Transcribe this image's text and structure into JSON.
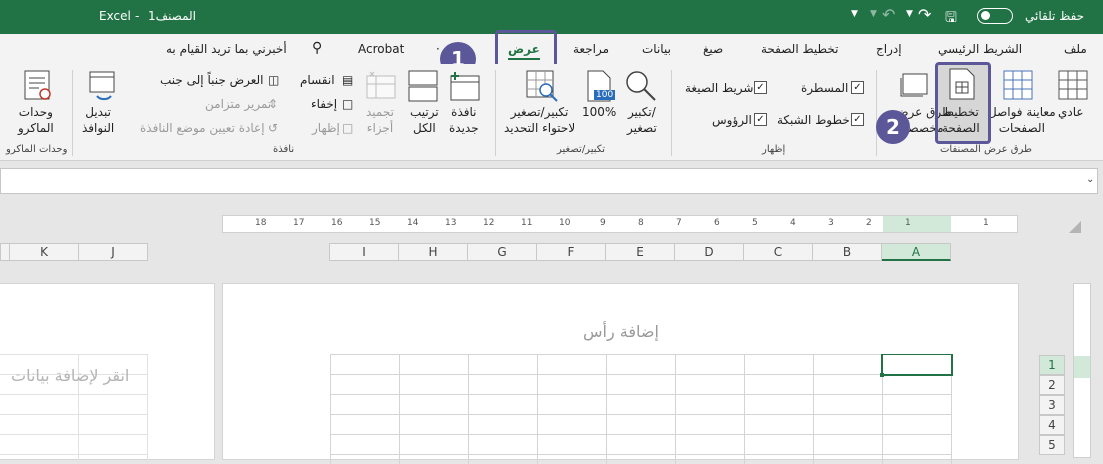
{
  "titlebar": {
    "autosave_label": "حفظ تلقائي",
    "doc_title": "المصنف1",
    "separator": "-",
    "app_name": "Excel"
  },
  "tabs": [
    {
      "label": "ملف"
    },
    {
      "label": "الشريط الرئيسي"
    },
    {
      "label": "إدراج"
    },
    {
      "label": "تخطيط الصفحة"
    },
    {
      "label": "صيغ"
    },
    {
      "label": "بيانات"
    },
    {
      "label": "مراجعة"
    },
    {
      "label": "عرض",
      "active": true
    },
    {
      "label": "Acrobat"
    }
  ],
  "tellme": "أخبرني بما تريد القيام به",
  "ribbon": {
    "workbook_views": {
      "group_label": "طرق عرض المصنفات",
      "normal": "عادي",
      "page_break_l1": "معاينة فواصل",
      "page_break_l2": "الصفحات",
      "page_layout_l1": "تخطيط",
      "page_layout_l2": "الصفحة",
      "custom_l1": "طرق عرض",
      "custom_l2": "مخصصة"
    },
    "show": {
      "group_label": "إظهار",
      "ruler": "المسطرة",
      "formula_bar": "شريط الصيغة",
      "gridlines": "خطوط الشبكة",
      "headings": "الرؤوس"
    },
    "zoom": {
      "group_label": "تكبير/تصغير",
      "zoom_l1": "تكبير/",
      "zoom_l2": "تصغير",
      "hundred": "100%",
      "badge": "100",
      "to_selection_l1": "تكبير/تصغير",
      "to_selection_l2": "لاحتواء التحديد"
    },
    "window": {
      "group_label": "نافذة",
      "new_window_l1": "نافذة",
      "new_window_l2": "جديدة",
      "arrange_l1": "ترتيب",
      "arrange_l2": "الكل",
      "freeze_l1": "تجميد",
      "freeze_l2": "أجزاء",
      "split": "انقسام",
      "hide": "إخفاء",
      "unhide": "إظهار",
      "side_by_side": "العرض جنباً إلى جنب",
      "sync_scroll": "تمرير متزامن",
      "reset_position": "إعادة تعيين موضع النافذة",
      "switch_l1": "تبديل",
      "switch_l2": "النوافذ"
    },
    "macros": {
      "group_label": "وحدات الماكرو",
      "macros_l1": "وحدات",
      "macros_l2": "الماكرو"
    }
  },
  "sheet": {
    "columns": [
      "A",
      "B",
      "C",
      "D",
      "E",
      "F",
      "G",
      "H",
      "I"
    ],
    "left_columns": [
      "J",
      "K"
    ],
    "rows": [
      "1",
      "2",
      "3",
      "4",
      "5"
    ],
    "header_placeholder": "إضافة رأس",
    "data_placeholder": "انقر لإضافة بيانات",
    "ruler_ticks": [
      "1",
      "1",
      "2",
      "3",
      "4",
      "5",
      "6",
      "7",
      "8",
      "9",
      "10",
      "11",
      "12",
      "13",
      "14",
      "15",
      "16",
      "17",
      "18"
    ]
  },
  "callouts": [
    "1",
    "2"
  ],
  "colors": {
    "excel_green": "#217346",
    "callout": "#5b5799",
    "selected_header": "#d2e8d9"
  }
}
